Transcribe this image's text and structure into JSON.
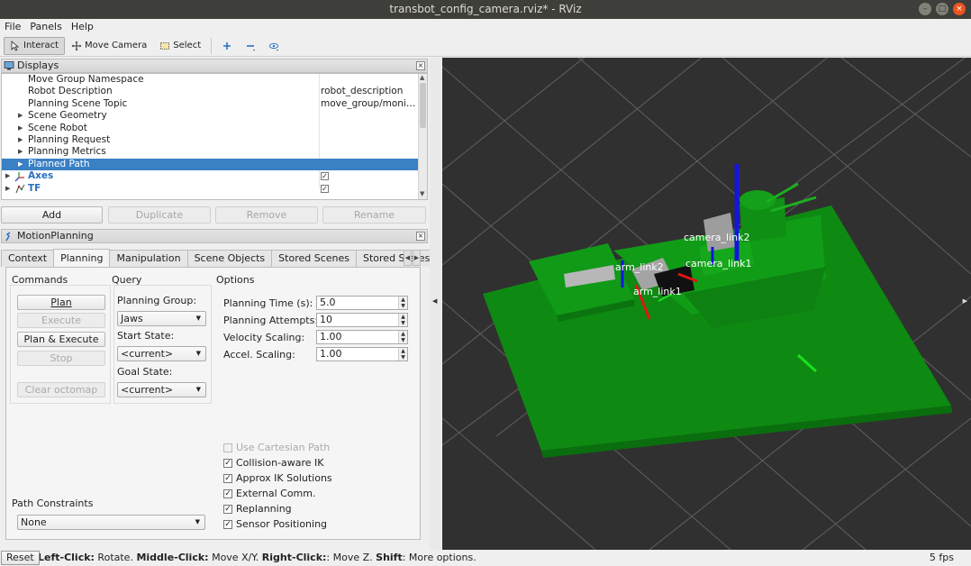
{
  "window": {
    "title": "transbot_config_camera.rviz* - RViz",
    "buttons": [
      "–",
      "□",
      "×"
    ]
  },
  "menu": [
    "File",
    "Panels",
    "Help"
  ],
  "toolbar": {
    "interact": "Interact",
    "move_camera": "Move Camera",
    "select": "Select"
  },
  "displays": {
    "title": "Displays",
    "rows": [
      {
        "name": "Move Group Namespace",
        "value": ""
      },
      {
        "name": "Robot Description",
        "value": "robot_description"
      },
      {
        "name": "Planning Scene Topic",
        "value": "move_group/monit..."
      },
      {
        "name": "Scene Geometry",
        "value": ""
      },
      {
        "name": "Scene Robot",
        "value": ""
      },
      {
        "name": "Planning Request",
        "value": ""
      },
      {
        "name": "Planning Metrics",
        "value": ""
      },
      {
        "name": "Planned Path",
        "value": ""
      },
      {
        "name": "Axes",
        "value": ""
      },
      {
        "name": "TF",
        "value": ""
      }
    ],
    "buttons": {
      "add": "Add",
      "duplicate": "Duplicate",
      "remove": "Remove",
      "rename": "Rename"
    }
  },
  "motion": {
    "title": "MotionPlanning",
    "tabs": [
      "Context",
      "Planning",
      "Manipulation",
      "Scene Objects",
      "Stored Scenes",
      "Stored States"
    ],
    "commands": {
      "title": "Commands",
      "plan": "Plan",
      "execute": "Execute",
      "plan_execute": "Plan & Execute",
      "stop": "Stop",
      "clear_octomap": "Clear octomap"
    },
    "query": {
      "title": "Query",
      "group_label": "Planning Group:",
      "group_value": "Jaws",
      "start_label": "Start State:",
      "start_value": "<current>",
      "goal_label": "Goal State:",
      "goal_value": "<current>"
    },
    "options": {
      "title": "Options",
      "fields": [
        {
          "label": "Planning Time (s):",
          "value": "5.0"
        },
        {
          "label": "Planning Attempts:",
          "value": "10"
        },
        {
          "label": "Velocity Scaling:",
          "value": "1.00"
        },
        {
          "label": "Accel. Scaling:",
          "value": "1.00"
        }
      ],
      "checks": [
        {
          "label": "Use Cartesian Path",
          "checked": false
        },
        {
          "label": "Collision-aware IK",
          "checked": true
        },
        {
          "label": "Approx IK Solutions",
          "checked": true
        },
        {
          "label": "External Comm.",
          "checked": true
        },
        {
          "label": "Replanning",
          "checked": true
        },
        {
          "label": "Sensor Positioning",
          "checked": true
        }
      ]
    },
    "path_constraints": {
      "label": "Path Constraints",
      "value": "None"
    }
  },
  "viewport": {
    "labels": [
      "camera_link2",
      "arm_link2",
      "arm_link1",
      "camera_link1"
    ]
  },
  "status": {
    "reset": "Reset",
    "parts": [
      {
        "b": "Left-Click:",
        "t": " Rotate. "
      },
      {
        "b": "Middle-Click:",
        "t": " Move X/Y. "
      },
      {
        "b": "Right-Click:",
        "t": ": Move Z. "
      },
      {
        "b": "Shift",
        "t": ": More options."
      }
    ],
    "fps": "5 fps"
  }
}
